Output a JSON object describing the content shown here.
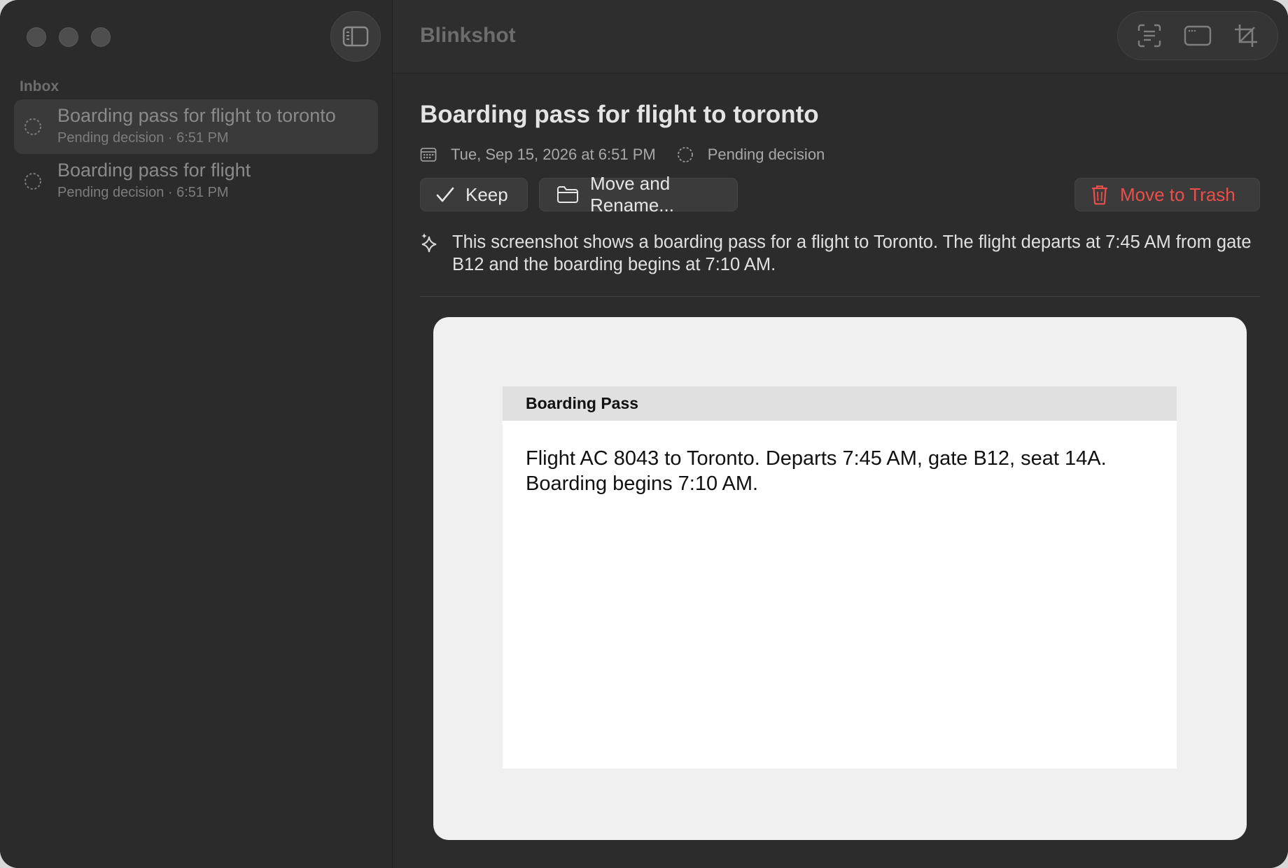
{
  "app": {
    "title": "Blinkshot"
  },
  "sidebar": {
    "section_label": "Inbox",
    "items": [
      {
        "title": "Boarding pass for flight to toronto",
        "subtitle": "Pending decision · 6:51 PM",
        "selected": true
      },
      {
        "title": "Boarding pass for flight",
        "subtitle": "Pending decision · 6:51 PM",
        "selected": false
      }
    ]
  },
  "detail": {
    "title": "Boarding pass for flight to toronto",
    "date": "Tue, Sep 15, 2026 at 6:51 PM",
    "status": "Pending decision",
    "actions": {
      "keep": "Keep",
      "move": "Move and Rename...",
      "trash": "Move to Trash"
    },
    "summary": "This screenshot shows a boarding pass for a flight to Toronto. The flight departs at 7:45 AM from gate B12 and the boarding begins at 7:10 AM."
  },
  "preview": {
    "header": "Boarding Pass",
    "body": "Flight AC 8043 to Toronto. Departs 7:45 AM, gate B12, seat 14A. Boarding begins 7:10 AM."
  },
  "icons": {
    "sidebar_toggle": "sidebar-toggle-icon",
    "toolbar": [
      "text-scan-icon",
      "window-icon",
      "crop-icon"
    ],
    "calendar": "calendar-icon",
    "status": "pending-circle-icon",
    "keep": "checkmark-icon",
    "move": "folder-icon",
    "trash": "trash-icon",
    "summary": "sparkles-icon"
  },
  "colors": {
    "danger": "#ea4f4a",
    "background": "#2c2c2c",
    "selected_row": "#3a3a3a"
  }
}
